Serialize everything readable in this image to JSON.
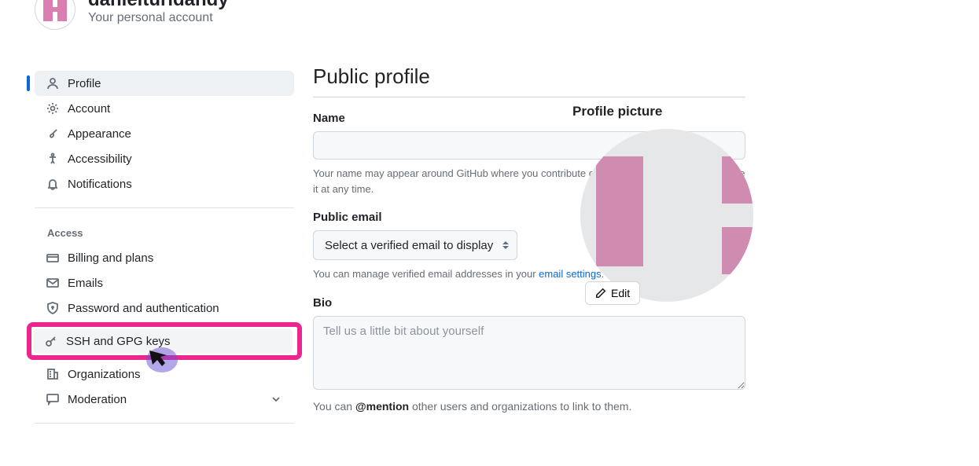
{
  "header": {
    "username": "danielturidandy",
    "subtitle": "Your personal account"
  },
  "sidebar": {
    "group1": [
      {
        "label": "Profile",
        "icon": "person-icon",
        "active": true
      },
      {
        "label": "Account",
        "icon": "gear-icon"
      },
      {
        "label": "Appearance",
        "icon": "brush-icon"
      },
      {
        "label": "Accessibility",
        "icon": "accessibility-icon"
      },
      {
        "label": "Notifications",
        "icon": "bell-icon"
      }
    ],
    "access_heading": "Access",
    "group2": [
      {
        "label": "Billing and plans",
        "icon": "credit-card-icon"
      },
      {
        "label": "Emails",
        "icon": "mail-icon"
      },
      {
        "label": "Password and authentication",
        "icon": "shield-lock-icon"
      },
      {
        "label": "SSH and GPG keys",
        "icon": "key-icon",
        "highlighted": true
      },
      {
        "label": "Organizations",
        "icon": "organization-icon"
      },
      {
        "label": "Moderation",
        "icon": "comment-icon",
        "chevron": true
      }
    ]
  },
  "main": {
    "title": "Public profile",
    "name_label": "Name",
    "name_help": "Your name may appear around GitHub where you contribute or are mentioned. You can remove it at any time.",
    "email_label": "Public email",
    "email_select": "Select a verified email to display",
    "email_help_pre": "You can manage verified email addresses in your ",
    "email_help_link": "email settings",
    "bio_label": "Bio",
    "bio_placeholder": "Tell us a little bit about yourself",
    "bio_help_pre": "You can ",
    "bio_help_bold": "@mention",
    "bio_help_post": " other users and organizations to link to them."
  },
  "profile_picture": {
    "heading": "Profile picture",
    "edit_label": "Edit"
  }
}
